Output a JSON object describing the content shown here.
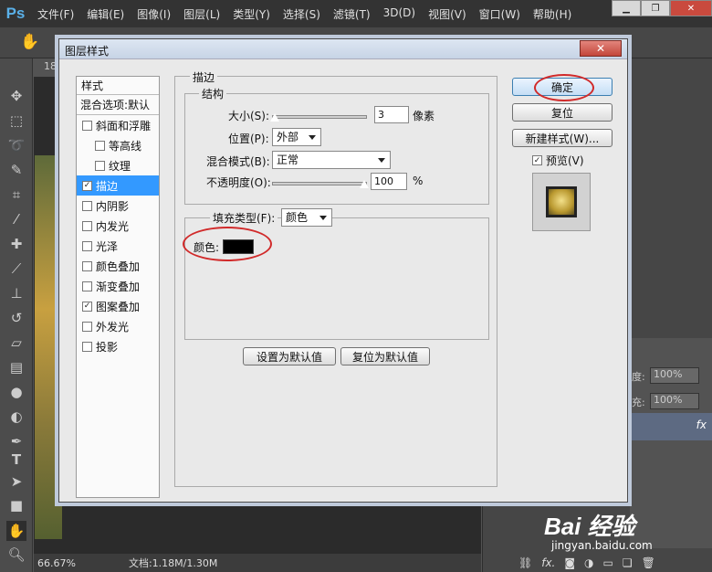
{
  "app": {
    "logo": "Ps",
    "menu": [
      "文件(F)",
      "编辑(E)",
      "图像(I)",
      "图层(L)",
      "类型(Y)",
      "选择(S)",
      "滤镜(T)",
      "3D(D)",
      "视图(V)",
      "窗口(W)",
      "帮助(H)"
    ],
    "tab_number": "18",
    "status_zoom": "66.67%",
    "status_doc": "文档:1.18M/1.30M",
    "layers": {
      "opacity_label": "度:",
      "opacity_value": "100%",
      "fill_label": "充:",
      "fill_value": "100%",
      "fx": "fx"
    }
  },
  "dialog": {
    "title": "图层样式",
    "close_glyph": "✕",
    "styles_header": "样式",
    "blend_options": "混合选项:默认",
    "styles": [
      {
        "label": "斜面和浮雕",
        "checked": false
      },
      {
        "label": "等高线",
        "checked": false
      },
      {
        "label": "纹理",
        "checked": false
      },
      {
        "label": "描边",
        "checked": true
      },
      {
        "label": "内阴影",
        "checked": false
      },
      {
        "label": "内发光",
        "checked": false
      },
      {
        "label": "光泽",
        "checked": false
      },
      {
        "label": "颜色叠加",
        "checked": false
      },
      {
        "label": "渐变叠加",
        "checked": false
      },
      {
        "label": "图案叠加",
        "checked": true
      },
      {
        "label": "外发光",
        "checked": false
      },
      {
        "label": "投影",
        "checked": false
      }
    ],
    "selected_style": "描边",
    "stroke": {
      "title": "描边",
      "structure_title": "结构",
      "size_label": "大小(S):",
      "size_value": "3",
      "size_unit": "像素",
      "position_label": "位置(P):",
      "position_value": "外部",
      "blend_mode_label": "混合模式(B):",
      "blend_mode_value": "正常",
      "opacity_label": "不透明度(O):",
      "opacity_value": "100",
      "opacity_unit": "%",
      "fill_type_label": "填充类型(F):",
      "fill_type_value": "颜色",
      "color_label": "颜色:",
      "color_value": "#000000"
    },
    "make_default": "设置为默认值",
    "reset_default": "复位为默认值",
    "ok": "确定",
    "reset": "复位",
    "new_style": "新建样式(W)...",
    "preview_label": "预览(V)",
    "preview_checked": true
  },
  "watermark": {
    "logo": "Bai 经验",
    "url": "jingyan.baidu.com"
  },
  "colors": {
    "highlight": "#d12a2a",
    "selection": "#3399ff"
  }
}
